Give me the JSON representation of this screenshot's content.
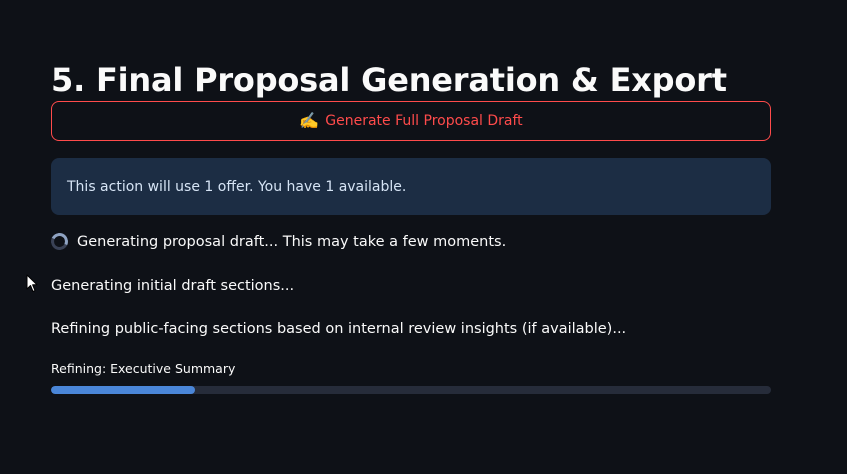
{
  "page": {
    "title": "5. Final Proposal Generation & Export"
  },
  "generate_button": {
    "icon": "writing-hand-icon",
    "icon_glyph": "✍️",
    "label": "Generate Full Proposal Draft"
  },
  "info_message": {
    "text": "This action will use 1 offer. You have 1 available."
  },
  "spinner": {
    "icon": "spinner-icon",
    "text": "Generating proposal draft... This may take a few moments."
  },
  "status_lines": [
    "Generating initial draft sections...",
    "Refining public-facing sections based on internal review insights (if available)..."
  ],
  "progress": {
    "label": "Refining: Executive Summary",
    "value": 0.2
  },
  "colors": {
    "background": "#0e1117",
    "button_accent": "#ff4b4b",
    "info_background": "#1c2d44",
    "progress_fill": "#4a86d8",
    "progress_track": "#262c3a"
  }
}
